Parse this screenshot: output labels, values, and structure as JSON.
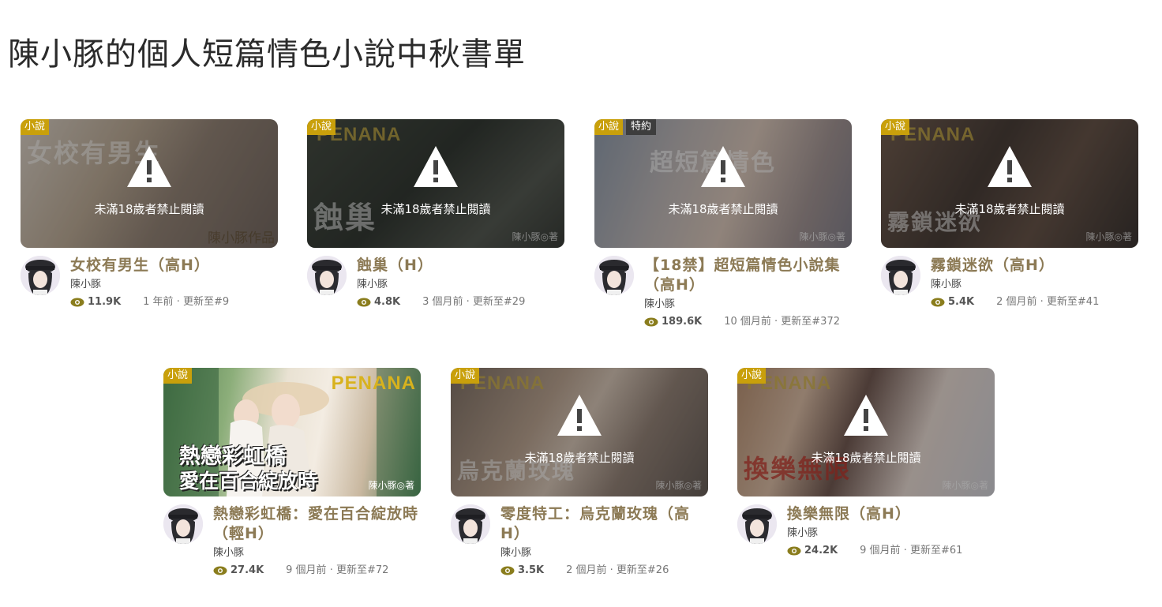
{
  "page_title": "陳小豚的個人短篇情色小說中秋書單",
  "labels": {
    "novel_tag": "小說",
    "exclusive_tag": "特約",
    "age_warning": "未滿18歲者禁止閱讀"
  },
  "colors": {
    "title_text": "#8c7a55",
    "tag_bg": "#c9a00b",
    "eye_icon": "#8a7d1d"
  },
  "books": [
    {
      "title": "女校有男生（高H）",
      "author": "陳小豚",
      "views": "11.9K",
      "updated": "1 年前 · 更新至#9",
      "cover_text": "女校有男生",
      "cover_brand": "",
      "cover_stamp": "陳小豚作品",
      "restricted": true,
      "exclusive": false
    },
    {
      "title": "蝕巢（H）",
      "author": "陳小豚",
      "views": "4.8K",
      "updated": "3 個月前 · 更新至#29",
      "cover_text": "蝕巢",
      "cover_brand": "PENANA",
      "cover_stamp": "陳小豚◎著",
      "restricted": true,
      "exclusive": false
    },
    {
      "title": "【18禁】超短篇情色小說集（高H）",
      "author": "陳小豚",
      "views": "189.6K",
      "updated": "10 個月前 · 更新至#372",
      "cover_text": "超短篇情色",
      "cover_brand": "",
      "cover_stamp": "陳小豚◎著",
      "restricted": true,
      "exclusive": true
    },
    {
      "title": "霧鎖迷欲（高H）",
      "author": "陳小豚",
      "views": "5.4K",
      "updated": "2 個月前 · 更新至#41",
      "cover_text": "霧鎖迷欲",
      "cover_brand": "PENANA",
      "cover_stamp": "陳小豚◎著",
      "restricted": true,
      "exclusive": false
    },
    {
      "title": "熱戀彩虹橋：愛在百合綻放時（輕H）",
      "author": "陳小豚",
      "views": "27.4K",
      "updated": "9 個月前 · 更新至#72",
      "cover_text": "熱戀彩虹橋",
      "cover_text2": "愛在百合綻放時",
      "cover_brand": "PENANA",
      "cover_stamp": "陳小豚◎著",
      "restricted": false,
      "exclusive": false
    },
    {
      "title": "零度特工：烏克蘭玫瑰（高H）",
      "author": "陳小豚",
      "views": "3.5K",
      "updated": "2 個月前 · 更新至#26",
      "cover_text": "烏克蘭玫瑰",
      "cover_brand": "PENANA",
      "cover_stamp": "陳小豚◎著",
      "restricted": true,
      "exclusive": false
    },
    {
      "title": "換樂無限（高H）",
      "author": "陳小豚",
      "views": "24.2K",
      "updated": "9 個月前 · 更新至#61",
      "cover_text": "換樂無限",
      "cover_brand": "PENANA",
      "cover_stamp": "陳小豚◎著",
      "restricted": true,
      "exclusive": false
    }
  ]
}
